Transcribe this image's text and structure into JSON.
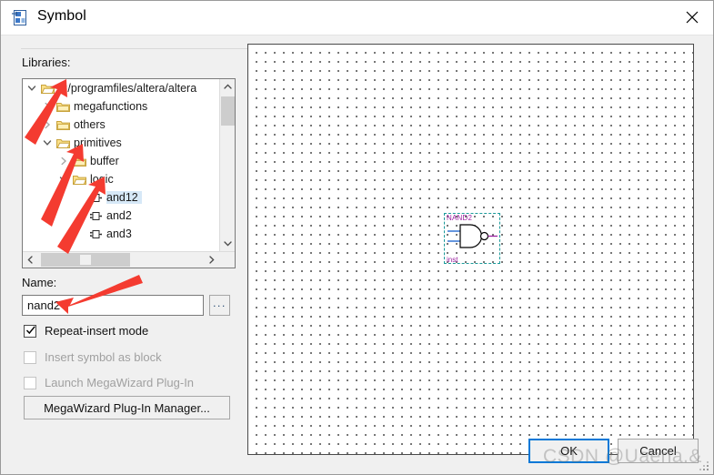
{
  "window": {
    "title": "Symbol",
    "icon": "symbol-file-icon",
    "close_label": "✕"
  },
  "left_panel": {
    "libraries_label": "Libraries:",
    "tree": [
      {
        "label": "d:/programfiles/altera/altera",
        "depth": 0,
        "state": "expanded",
        "icon": "folder-open-icon",
        "selected": false
      },
      {
        "label": "megafunctions",
        "depth": 1,
        "state": "collapsed",
        "icon": "folder-icon",
        "selected": false
      },
      {
        "label": "others",
        "depth": 1,
        "state": "collapsed",
        "icon": "folder-icon",
        "selected": false
      },
      {
        "label": "primitives",
        "depth": 1,
        "state": "expanded",
        "icon": "folder-open-icon",
        "selected": false
      },
      {
        "label": "buffer",
        "depth": 2,
        "state": "collapsed",
        "icon": "folder-icon",
        "selected": false
      },
      {
        "label": "logic",
        "depth": 2,
        "state": "expanded",
        "icon": "folder-open-icon",
        "selected": false
      },
      {
        "label": "and12",
        "depth": 3,
        "state": "leaf",
        "icon": "symbol-icon",
        "selected": true
      },
      {
        "label": "and2",
        "depth": 3,
        "state": "leaf",
        "icon": "symbol-icon",
        "selected": false
      },
      {
        "label": "and3",
        "depth": 3,
        "state": "leaf",
        "icon": "symbol-icon",
        "selected": false
      }
    ],
    "name_label": "Name:",
    "name_value": "nand2",
    "name_placeholder": "",
    "browse_label": "...",
    "checkboxes": [
      {
        "label": "Repeat-insert mode",
        "checked": true,
        "enabled": true
      },
      {
        "label": "Insert symbol as block",
        "checked": false,
        "enabled": false
      },
      {
        "label": "Launch MegaWizard Plug-In",
        "checked": false,
        "enabled": false
      }
    ],
    "megawizard_label": "MegaWizard Plug-In Manager..."
  },
  "preview": {
    "symbol_name": "NAND2",
    "instance_name": "inst",
    "grid": "dotted",
    "selection": "dashed-teal"
  },
  "footer": {
    "ok_label": "OK",
    "cancel_label": "Cancel",
    "resize_grip": "resize-grip"
  },
  "watermark": {
    "text": "CSDN @Uaena.&"
  },
  "colors": {
    "accent": "#0078d7",
    "selection_bg": "#d6e8f7",
    "symbol_text": "#9b1fa0",
    "symbol_wire": "#0050c8",
    "symbol_out": "#9b1fa0",
    "selection_box": "#1a9a9a",
    "annotation_arrow": "#f43b30",
    "dialog_bg": "#f0f0f0"
  },
  "annotations": {
    "arrow_count": 4,
    "targets": [
      "tree-root-folder",
      "primitives-folder",
      "logic-folder",
      "name-input"
    ]
  }
}
